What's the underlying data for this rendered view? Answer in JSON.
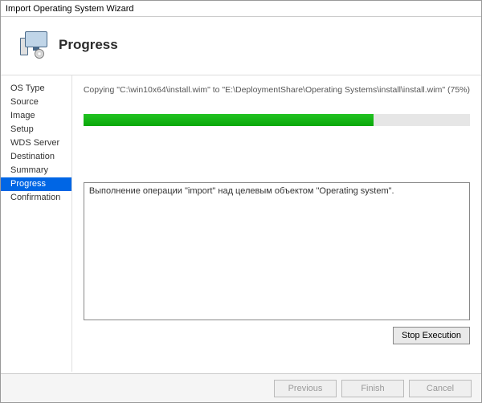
{
  "window": {
    "title": "Import Operating System Wizard"
  },
  "header": {
    "title": "Progress"
  },
  "sidebar": {
    "items": [
      {
        "label": "OS Type",
        "selected": false
      },
      {
        "label": "Source",
        "selected": false
      },
      {
        "label": "Image",
        "selected": false
      },
      {
        "label": "Setup",
        "selected": false
      },
      {
        "label": "WDS Server",
        "selected": false
      },
      {
        "label": "Destination",
        "selected": false
      },
      {
        "label": "Summary",
        "selected": false
      },
      {
        "label": "Progress",
        "selected": true
      },
      {
        "label": "Confirmation",
        "selected": false
      }
    ]
  },
  "main": {
    "status_text": "Copying \"C:\\win10x64\\install.wim\" to \"E:\\DeploymentShare\\Operating Systems\\install\\install.wim\" (75%)",
    "progress_percent": 75,
    "log_text": "Выполнение операции \"import\" над целевым объектом \"Operating system\".",
    "stop_button_label": "Stop Execution"
  },
  "footer": {
    "previous_label": "Previous",
    "finish_label": "Finish",
    "cancel_label": "Cancel",
    "previous_enabled": false,
    "finish_enabled": false,
    "cancel_enabled": false
  }
}
